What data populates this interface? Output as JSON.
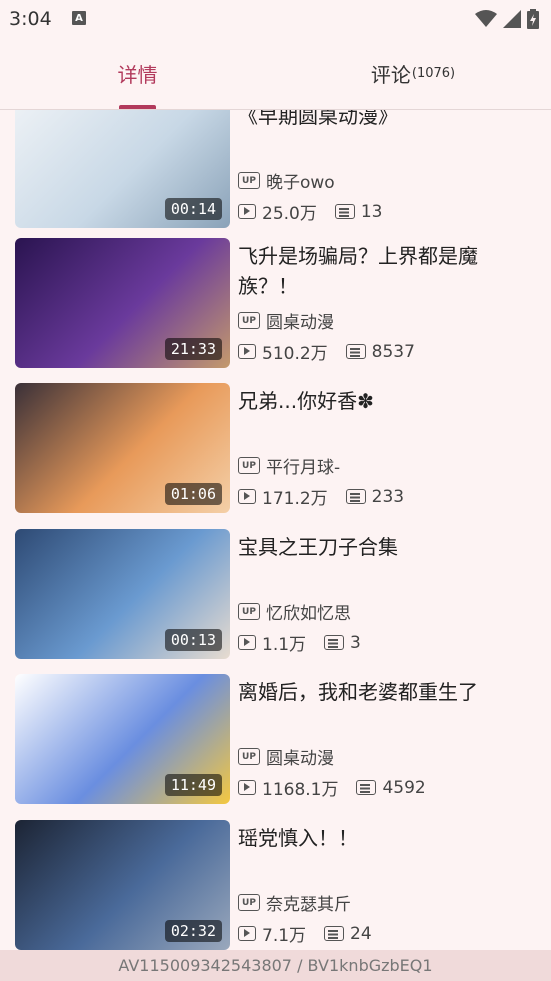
{
  "status_bar": {
    "time": "3:04",
    "notification_badge": "A"
  },
  "tabs": [
    {
      "label": "详情",
      "active": true
    },
    {
      "label": "评论",
      "count": "(1076)",
      "active": false
    }
  ],
  "videos": [
    {
      "title": "《早期圆桌动漫》",
      "uploader": "晚子owo",
      "views": "25.0万",
      "danmaku": "13",
      "duration": "00:14",
      "thumb_colors": [
        "#eef2f6",
        "#c8d8e6",
        "#8aa2b8"
      ]
    },
    {
      "title": "飞升是场骗局？上界都是魔族？！",
      "uploader": "圆桌动漫",
      "views": "510.2万",
      "danmaku": "8537",
      "duration": "21:33",
      "thumb_colors": [
        "#2a1450",
        "#6a3a9c",
        "#c49a6c"
      ]
    },
    {
      "title": "兄弟...你好香✽",
      "uploader": "平行月球-",
      "views": "171.2万",
      "danmaku": "233",
      "duration": "01:06",
      "thumb_colors": [
        "#3a3038",
        "#e89a5a",
        "#f4d0a8"
      ]
    },
    {
      "title": "宝具之王刀子合集",
      "uploader": "忆欣如忆思",
      "views": "1.1万",
      "danmaku": "3",
      "duration": "00:13",
      "thumb_colors": [
        "#2e4a74",
        "#6a9ad0",
        "#e8dcd0"
      ]
    },
    {
      "title": "离婚后，我和老婆都重生了",
      "uploader": "圆桌动漫",
      "views": "1168.1万",
      "danmaku": "4592",
      "duration": "11:49",
      "thumb_colors": [
        "#ffffff",
        "#6a8ee0",
        "#f4c840"
      ]
    },
    {
      "title": "瑶党慎入！！",
      "uploader": "奈克瑟其斤",
      "views": "7.1万",
      "danmaku": "24",
      "duration": "02:32",
      "thumb_colors": [
        "#1c2434",
        "#4a6a9a",
        "#9aa8bc"
      ]
    }
  ],
  "footer": {
    "id_text": "AV115009342543807 / BV1knbGzbEQ1"
  }
}
